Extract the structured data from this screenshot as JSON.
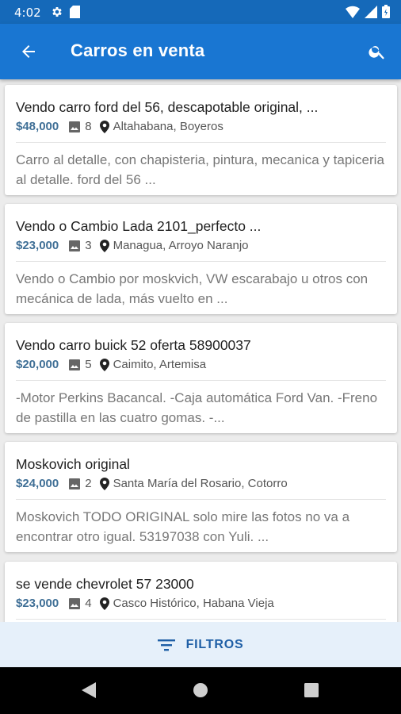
{
  "status_bar": {
    "time": "4:02"
  },
  "app_bar": {
    "title": "Carros en venta"
  },
  "listings": [
    {
      "title": "Vendo carro ford del 56, descapotable original, ...",
      "price": "$48,000",
      "photos": "8",
      "location": "Altahabana, Boyeros",
      "description": "Carro al detalle, con chapisteria, pintura, mecanica y tapiceria al detalle. ford del 56 ..."
    },
    {
      "title": "Vendo o Cambio Lada 2101_perfecto ...",
      "price": "$23,000",
      "photos": "3",
      "location": "Managua, Arroyo Naranjo",
      "description": "Vendo o Cambio por moskvich, VW escarabajo u otros con mecánica de lada, más vuelto en ..."
    },
    {
      "title": "Vendo carro buick 52 oferta 58900037",
      "price": "$20,000",
      "photos": "5",
      "location": "Caimito, Artemisa",
      "description": "-Motor Perkins Bacancal. -Caja automática Ford Van. -Freno de pastilla en las cuatro gomas. -..."
    },
    {
      "title": "Moskovich original",
      "price": "$24,000",
      "photos": "2",
      "location": "Santa María del Rosario, Cotorro",
      "description": "Moskovich TODO ORIGINAL solo mire las fotos no va a encontrar otro igual. 53197038 con Yuli. ..."
    },
    {
      "title": "se vende chevrolet 57 23000",
      "price": "$23,000",
      "photos": "4",
      "location": "Casco Histórico, Habana Vieja",
      "description": ""
    }
  ],
  "filters": {
    "label": "FILTROS"
  },
  "colors": {
    "status_bar": "#1569b9",
    "app_bar": "#1976d2",
    "price": "#3f6f96",
    "filters_bg": "#e6f0fa",
    "filters_text": "#1f5fa6"
  }
}
